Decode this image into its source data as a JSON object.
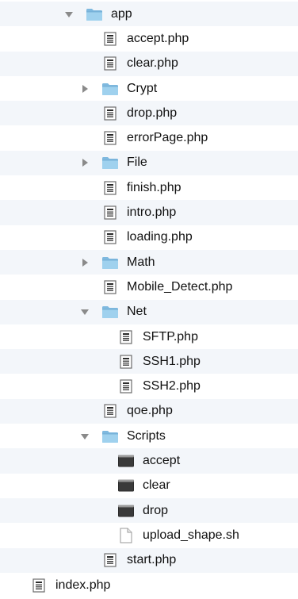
{
  "tree": {
    "rows": [
      {
        "label": "app",
        "kind": "folder",
        "depth": 0,
        "expanded": true,
        "icon": "folder-icon"
      },
      {
        "label": "accept.php",
        "kind": "doc",
        "depth": 1,
        "icon": "php-file-icon"
      },
      {
        "label": "clear.php",
        "kind": "doc",
        "depth": 1,
        "icon": "php-file-icon"
      },
      {
        "label": "Crypt",
        "kind": "folder",
        "depth": 1,
        "expanded": false,
        "icon": "folder-icon"
      },
      {
        "label": "drop.php",
        "kind": "doc",
        "depth": 1,
        "icon": "php-file-icon"
      },
      {
        "label": "errorPage.php",
        "kind": "doc",
        "depth": 1,
        "icon": "php-file-icon"
      },
      {
        "label": "File",
        "kind": "folder",
        "depth": 1,
        "expanded": false,
        "icon": "folder-icon"
      },
      {
        "label": "finish.php",
        "kind": "doc",
        "depth": 1,
        "icon": "php-file-icon"
      },
      {
        "label": "intro.php",
        "kind": "doc",
        "depth": 1,
        "icon": "php-file-icon"
      },
      {
        "label": "loading.php",
        "kind": "doc",
        "depth": 1,
        "icon": "php-file-icon"
      },
      {
        "label": "Math",
        "kind": "folder",
        "depth": 1,
        "expanded": false,
        "icon": "folder-icon"
      },
      {
        "label": "Mobile_Detect.php",
        "kind": "doc",
        "depth": 1,
        "icon": "php-file-icon"
      },
      {
        "label": "Net",
        "kind": "folder",
        "depth": 1,
        "expanded": true,
        "icon": "folder-icon"
      },
      {
        "label": "SFTP.php",
        "kind": "doc",
        "depth": 2,
        "icon": "php-file-icon"
      },
      {
        "label": "SSH1.php",
        "kind": "doc",
        "depth": 2,
        "icon": "php-file-icon"
      },
      {
        "label": "SSH2.php",
        "kind": "doc",
        "depth": 2,
        "icon": "php-file-icon"
      },
      {
        "label": "qoe.php",
        "kind": "doc",
        "depth": 1,
        "icon": "php-file-icon"
      },
      {
        "label": "Scripts",
        "kind": "folder",
        "depth": 1,
        "expanded": true,
        "icon": "folder-icon"
      },
      {
        "label": "accept",
        "kind": "exec",
        "depth": 2,
        "icon": "executable-icon"
      },
      {
        "label": "clear",
        "kind": "exec",
        "depth": 2,
        "icon": "executable-icon"
      },
      {
        "label": "drop",
        "kind": "exec",
        "depth": 2,
        "icon": "executable-icon"
      },
      {
        "label": "upload_shape.sh",
        "kind": "blank",
        "depth": 2,
        "icon": "blank-file-icon"
      },
      {
        "label": "start.php",
        "kind": "doc",
        "depth": 1,
        "icon": "php-file-icon"
      },
      {
        "label": "index.php",
        "kind": "doc",
        "depth": 0,
        "icon": "php-file-icon",
        "no_disclosure": true
      }
    ],
    "colors": {
      "row_alt_bg": "#f3f6fa",
      "row_bg": "#ffffff",
      "folder_fill": "#9fd1ee",
      "folder_tab": "#7fb9df",
      "triangle": "#8a8a8a"
    }
  }
}
